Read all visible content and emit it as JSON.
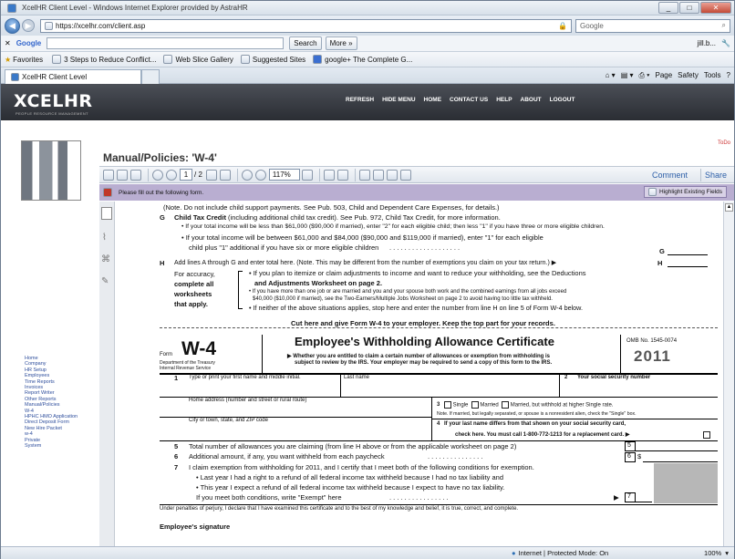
{
  "window": {
    "title": "XcelHR Client Level - Windows Internet Explorer provided by AstraHR"
  },
  "address": {
    "url": "https://xcelhr.com/client.asp",
    "search_placeholder": "Google"
  },
  "toolbar": {
    "google_label": "Google",
    "search_label": "Search",
    "more_label": "More »",
    "signin_label": "jill.b..."
  },
  "favorites": {
    "label": "Favorites",
    "items": [
      "3 Steps to Reduce Conflict...",
      "Web Slice Gallery",
      "Suggested Sites",
      "google+ The Complete G..."
    ]
  },
  "tab": {
    "title": "XcelHR Client Level",
    "cmd": [
      "Page",
      "Safety",
      "Tools"
    ]
  },
  "site": {
    "logo": "XCELHR",
    "logo_sub": "PEOPLE RESOURCE MANAGEMENT",
    "nav": [
      "REFRESH",
      "HIDE MENU",
      "HOME",
      "CONTACT US",
      "HELP",
      "ABOUT",
      "LOGOUT"
    ],
    "todo": "ToDo"
  },
  "sidebar": {
    "items": [
      "Home",
      "Company",
      "HR Setup",
      "Employees",
      "Time Reports",
      "Invoices",
      "Report Writer",
      "Other Reports",
      "Manual/Policies",
      "W-4",
      "HPHC HMO Application",
      "Direct Deposit Form",
      "New Hire Packet",
      "w-4",
      "Private",
      "System"
    ]
  },
  "page": {
    "title": "Manual/Policies: 'W-4'"
  },
  "pdf": {
    "page": "1",
    "pages": "/ 2",
    "zoom": "117%",
    "comment": "Comment",
    "share": "Share",
    "notice": "Please fill out the following form.",
    "highlight": "Highlight Existing Fields"
  },
  "form": {
    "l1": "(Note. Do not include child support payments. See Pub. 503, Child and Dependent Care Expenses, for details.)",
    "g_letter": "G",
    "g_bold": "Child Tax Credit",
    "g_text": "(including additional child tax credit). See Pub. 972, Child Tax Credit, for more information.",
    "g_b1": "• If your total income will be less than $61,000 ($90,000 if married), enter \"2\" for each eligible child; then less \"1\" if you have three or more eligible children.",
    "g_b2": "• If your total income will be between $61,000 and $84,000 ($90,000 and $119,000 if married), enter \"1\" for each eligible",
    "g_b3": "child plus \"1\" additional if you have six or more eligible children",
    "g_dots": ". . . . . . . . . . . . . . . . . . .",
    "g_right": "G",
    "h_letter": "H",
    "h_text": "Add lines A through G and enter total here. (Note. This may be different from the number of exemptions you claim on your tax return.) ▶",
    "h_right": "H",
    "h_left": [
      "For accuracy,",
      "complete all",
      "worksheets",
      "that apply."
    ],
    "h_r1": "• If you plan to itemize or claim adjustments to income and want to reduce your withholding, see the Deductions",
    "h_r2": "and Adjustments Worksheet on page 2.",
    "h_r3": "• If you have more than one job or are married and you and your spouse both work and the combined earnings from all jobs exceed",
    "h_r4": "$40,000 ($10,000 if married), see the Two-Earners/Multiple Jobs Worksheet on page 2 to avoid having too little tax withheld.",
    "h_r5": "• If neither of the above situations applies, stop here and enter the number from line H on line 5 of Form W-4 below.",
    "cut": "Cut here and give Form W-4 to your employer. Keep the top part for your records.",
    "form_label": "Form",
    "w4": "W-4",
    "dept": "Department of the Treasury",
    "irs": "Internal Revenue Service",
    "cert_title": "Employee's Withholding Allowance Certificate",
    "cert_sub1": "▶ Whether you are entitled to claim a certain number of allowances or exemption from withholding is",
    "cert_sub2": "subject to review by the IRS. Your employer may be required to send a copy of this form to the IRS.",
    "omb": "OMB No. 1545-0074",
    "year": "2011",
    "f1_num": "1",
    "f1": "Type or print your first name and middle initial.",
    "last": "Last name",
    "f2_num": "2",
    "ssn": "Your social security number",
    "home": "Home address (number and street or rural route)",
    "f3_num": "3",
    "single": "Single",
    "married": "Married",
    "married_higher": "Married, but withhold at higher Single rate.",
    "note3": "Note. If married, but legally separated, or spouse is a nonresident alien, check the \"Single\" box.",
    "city": "City or town, state, and ZIP code",
    "f4_num": "4",
    "f4a": "If your last name differs from that shown on your social security card,",
    "f4b": "check here. You must call 1-800-772-1213 for a replacement card. ▶",
    "l5_num": "5",
    "l5": "Total number of allowances you are claiming (from line H above or from the applicable worksheet on page 2)",
    "l5_box": "5",
    "l6_num": "6",
    "l6": "Additional amount, if any, you want withheld from each paycheck",
    "l6_dots": ". . . . . . . . . . . . . . .",
    "l6_box": "6",
    "l6_dollar": "$",
    "l7_num": "7",
    "l7": "I claim exemption from withholding for 2011, and I certify that I meet both of the following conditions for exemption.",
    "l7a": "• Last year I had a right to a refund of all federal income tax withheld because I had no tax liability and",
    "l7b": "• This year I expect a refund of all federal income tax withheld because I expect to have no tax liability.",
    "l7c": "If you meet both conditions, write \"Exempt\" here",
    "l7_dots": ". . . . . . . . . . . . . . . .",
    "l7_arrow": "▶",
    "l7_box": "7",
    "perjury": "Under penalties of perjury, I declare that I have examined this certificate and to the best of my knowledge and belief, it is true, correct, and complete.",
    "sig": "Employee's signature"
  },
  "status": {
    "zone": "Internet | Protected Mode: On",
    "zoom": "100%"
  }
}
